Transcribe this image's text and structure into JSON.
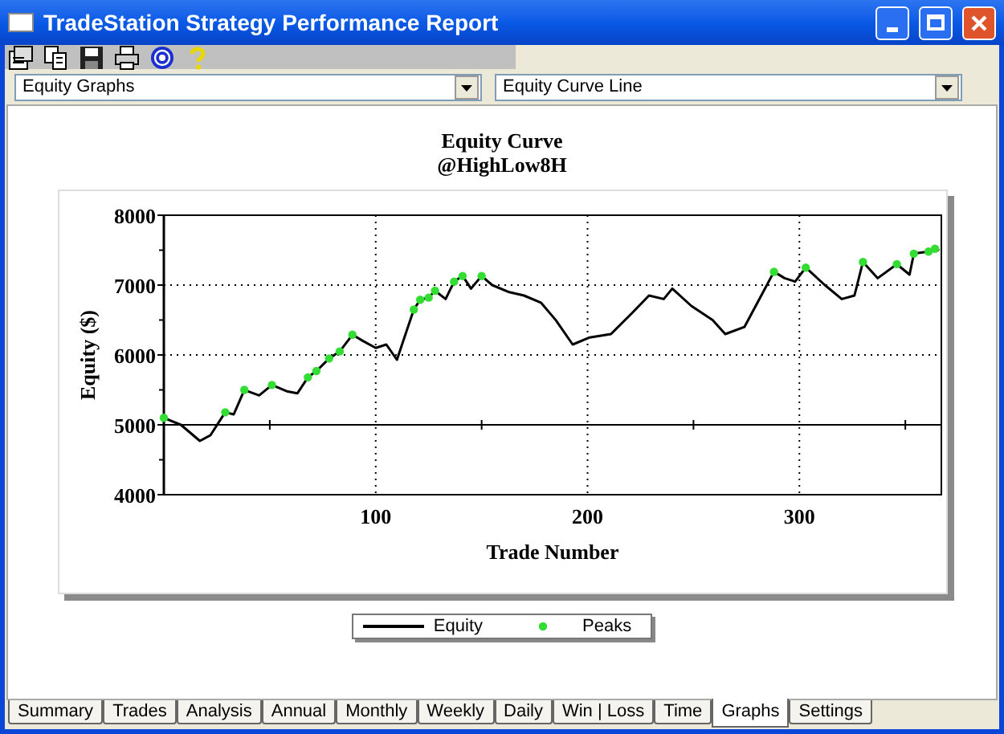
{
  "window": {
    "title": "TradeStation Strategy Performance Report"
  },
  "toolbar": {
    "items": [
      {
        "kind": "properties"
      },
      {
        "kind": "copy"
      },
      {
        "kind": "save"
      },
      {
        "kind": "print"
      },
      {
        "kind": "target"
      },
      {
        "kind": "help"
      }
    ]
  },
  "selectors": [
    {
      "value": "Equity Graphs"
    },
    {
      "value": "Equity Curve Line"
    }
  ],
  "chart": {
    "subtitle": "@HighLow8H",
    "chart_data": {
      "type": "line",
      "title": "Equity Curve",
      "xlabel": "Trade Number",
      "ylabel": "Equity ($)",
      "xlim": [
        0,
        367
      ],
      "ylim": [
        4000,
        8000
      ],
      "xticks": [
        100,
        200,
        300
      ],
      "yticks": [
        4000,
        5000,
        6000,
        7000,
        8000
      ],
      "grid": true,
      "ref_lines": [
        {
          "axis": "y",
          "value": 5000
        }
      ],
      "x": [
        0,
        8,
        17,
        22,
        29,
        33,
        38,
        45,
        51,
        58,
        63,
        68,
        72,
        78,
        83,
        89,
        94,
        100,
        105,
        110,
        118,
        121,
        125,
        128,
        133,
        137,
        141,
        145,
        150,
        155,
        163,
        170,
        178,
        185,
        193,
        201,
        211,
        221,
        229,
        236,
        240,
        249,
        259,
        265,
        274,
        282,
        288,
        293,
        298,
        303,
        312,
        320,
        326,
        330,
        337,
        346,
        352,
        354,
        361,
        364,
        366
      ],
      "series": [
        {
          "name": "Equity",
          "color": "#000000",
          "values": [
            5100,
            5000,
            4770,
            4850,
            5180,
            5150,
            5500,
            5420,
            5570,
            5480,
            5450,
            5680,
            5770,
            5950,
            6050,
            6290,
            6200,
            6100,
            6150,
            5930,
            6650,
            6790,
            6820,
            6920,
            6800,
            7050,
            7130,
            6950,
            7130,
            7000,
            6900,
            6850,
            6750,
            6500,
            6150,
            6250,
            6300,
            6600,
            6850,
            6800,
            6950,
            6700,
            6500,
            6300,
            6400,
            6850,
            7190,
            7100,
            7050,
            7250,
            7000,
            6800,
            6850,
            7330,
            7100,
            7300,
            7150,
            7450,
            7480,
            7520,
            7500
          ]
        },
        {
          "name": "Peaks",
          "type": "scatter",
          "color": "#33dd33",
          "values": [
            5100,
            null,
            null,
            null,
            5180,
            null,
            5500,
            null,
            5570,
            null,
            null,
            5680,
            5770,
            5950,
            6050,
            6290,
            null,
            null,
            null,
            null,
            6650,
            6790,
            6820,
            6920,
            null,
            7050,
            7130,
            null,
            7130,
            null,
            null,
            null,
            null,
            null,
            null,
            null,
            null,
            null,
            null,
            null,
            null,
            null,
            null,
            null,
            null,
            null,
            7190,
            null,
            null,
            7250,
            null,
            null,
            null,
            7330,
            null,
            7300,
            null,
            7450,
            7480,
            7520,
            null
          ]
        }
      ]
    }
  },
  "tabs": [
    {
      "label": "Summary",
      "selected": false
    },
    {
      "label": "Trades",
      "selected": false
    },
    {
      "label": "Analysis",
      "selected": false
    },
    {
      "label": "Annual",
      "selected": false
    },
    {
      "label": "Monthly",
      "selected": false
    },
    {
      "label": "Weekly",
      "selected": false
    },
    {
      "label": "Daily",
      "selected": false
    },
    {
      "label": "Win | Loss",
      "selected": false
    },
    {
      "label": "Time",
      "selected": false
    },
    {
      "label": "Graphs",
      "selected": true
    },
    {
      "label": "Settings",
      "selected": false
    }
  ]
}
